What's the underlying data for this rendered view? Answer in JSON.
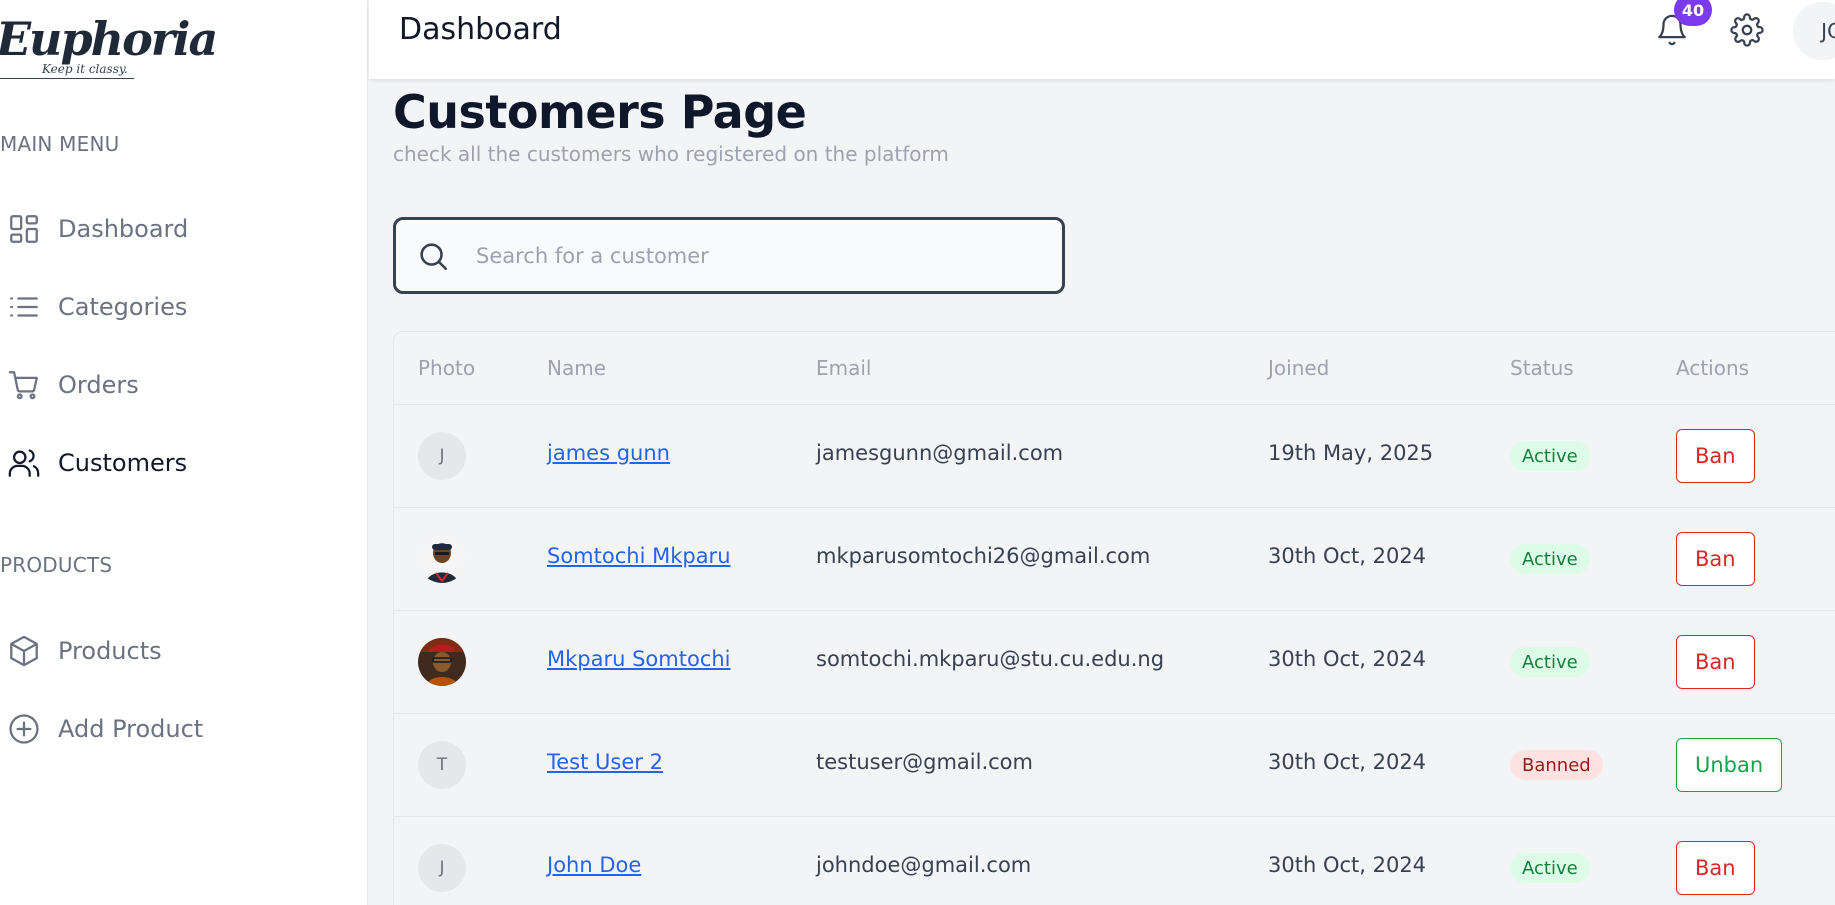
{
  "sidebar": {
    "logo": {
      "name": "Euphoria",
      "tagline": "Keep it classy."
    },
    "sections": [
      {
        "label": "MAIN MENU",
        "items": [
          {
            "label": "Dashboard",
            "icon": "dashboard-grid-icon"
          },
          {
            "label": "Categories",
            "icon": "list-icon"
          },
          {
            "label": "Orders",
            "icon": "cart-icon"
          },
          {
            "label": "Customers",
            "icon": "users-icon",
            "active": true
          }
        ]
      },
      {
        "label": "PRODUCTS",
        "items": [
          {
            "label": "Products",
            "icon": "box-icon"
          },
          {
            "label": "Add Product",
            "icon": "plus-circle-icon"
          }
        ]
      }
    ]
  },
  "header": {
    "title": "Dashboard",
    "notifications": "40",
    "user_initials": "JO"
  },
  "page": {
    "title": "Customers Page",
    "subtitle": "check all the customers who registered on the platform"
  },
  "search": {
    "placeholder": "Search for a customer",
    "value": ""
  },
  "table": {
    "columns": [
      "Photo",
      "Name",
      "Email",
      "Joined",
      "Status",
      "Actions"
    ],
    "rows": [
      {
        "photo": "J",
        "name": "james gunn",
        "email": "jamesgunn@gmail.com",
        "joined": "19th May, 2025",
        "status": "Active",
        "action": "Ban"
      },
      {
        "photo": "",
        "name": "Somtochi Mkparu",
        "email": "mkparusomtochi26@gmail.com",
        "joined": "30th Oct, 2024",
        "status": "Active",
        "action": "Ban"
      },
      {
        "photo": "",
        "name": "Mkparu Somtochi",
        "email": "somtochi.mkparu@stu.cu.edu.ng",
        "joined": "30th Oct, 2024",
        "status": "Active",
        "action": "Ban"
      },
      {
        "photo": "T",
        "name": "Test User 2",
        "email": "testuser@gmail.com",
        "joined": "30th Oct, 2024",
        "status": "Banned",
        "action": "Unban"
      },
      {
        "photo": "J",
        "name": "John Doe",
        "email": "johndoe@gmail.com",
        "joined": "30th Oct, 2024",
        "status": "Active",
        "action": "Ban"
      }
    ]
  },
  "colors": {
    "accent": "#7c3aed",
    "link": "#2563eb",
    "active_bg": "#dcfce7",
    "active_text": "#15803d",
    "banned_bg": "#fee2e2",
    "banned_text": "#991b1b",
    "ban": "#dc2626",
    "unban": "#16a34a"
  }
}
